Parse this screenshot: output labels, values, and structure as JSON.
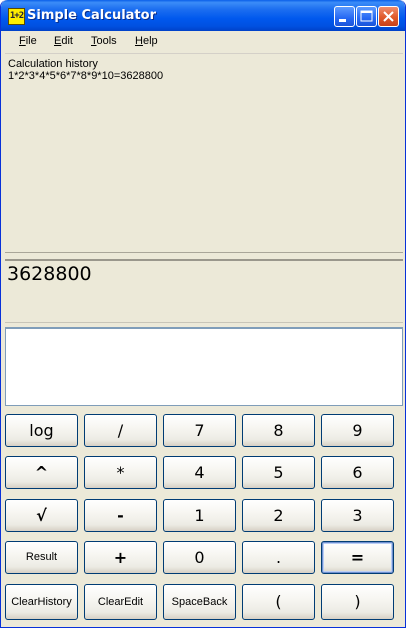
{
  "window": {
    "title": "Simple Calculator",
    "icon_text": "1+2",
    "controls": [
      "minimize-icon",
      "maximize-icon",
      "close-icon"
    ]
  },
  "menu": [
    {
      "mnemonic": "F",
      "rest": "ile"
    },
    {
      "mnemonic": "E",
      "rest": "dit"
    },
    {
      "mnemonic": "T",
      "rest": "ools"
    },
    {
      "mnemonic": "H",
      "rest": "elp"
    }
  ],
  "history": {
    "header": "Calculation history",
    "entries": [
      "1*2*3*4*5*6*7*8*9*10=3628800"
    ]
  },
  "result": {
    "value": "3628800"
  },
  "edit": {
    "value": ""
  },
  "keypad": [
    [
      "log",
      "/",
      "7",
      "8",
      "9"
    ],
    [
      "^",
      "*",
      "4",
      "5",
      "6"
    ],
    [
      "√",
      "-",
      "1",
      "2",
      "3"
    ],
    [
      "Result",
      "+",
      "0",
      ".",
      "="
    ],
    [
      "ClearHistory",
      "ClearEdit",
      "SpaceBack",
      "(",
      ")"
    ]
  ],
  "colors": {
    "titlebar": "#0058ee",
    "window_face": "#ece9d8",
    "button_border": "#003c74",
    "close_button": "#e05a2a"
  }
}
